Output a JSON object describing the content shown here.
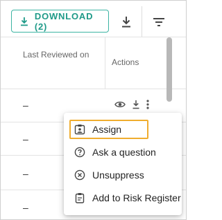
{
  "toolbar": {
    "download_label": "DOWNLOAD (2)",
    "download_icon": "download-icon",
    "export_icon": "download-icon",
    "filter_icon": "filter-icon"
  },
  "table": {
    "columns": [
      "Last Reviewed on",
      "Actions"
    ],
    "rows": [
      {
        "last_reviewed": "–"
      },
      {
        "last_reviewed": "–"
      },
      {
        "last_reviewed": "–"
      },
      {
        "last_reviewed": "–"
      },
      {
        "last_reviewed": "–"
      }
    ],
    "row_action_icons": [
      "eye-icon",
      "download-icon",
      "more-vertical-icon"
    ]
  },
  "context_menu": {
    "items": [
      {
        "label": "Assign",
        "icon": "assign-badge-icon",
        "highlighted": true
      },
      {
        "label": "Ask a question",
        "icon": "help-circle-icon"
      },
      {
        "label": "Unsuppress",
        "icon": "close-circle-icon"
      },
      {
        "label": "Add to Risk Register",
        "icon": "clipboard-icon"
      }
    ]
  },
  "colors": {
    "accent": "#1e9a88",
    "highlight_border": "#f0ad2e"
  }
}
